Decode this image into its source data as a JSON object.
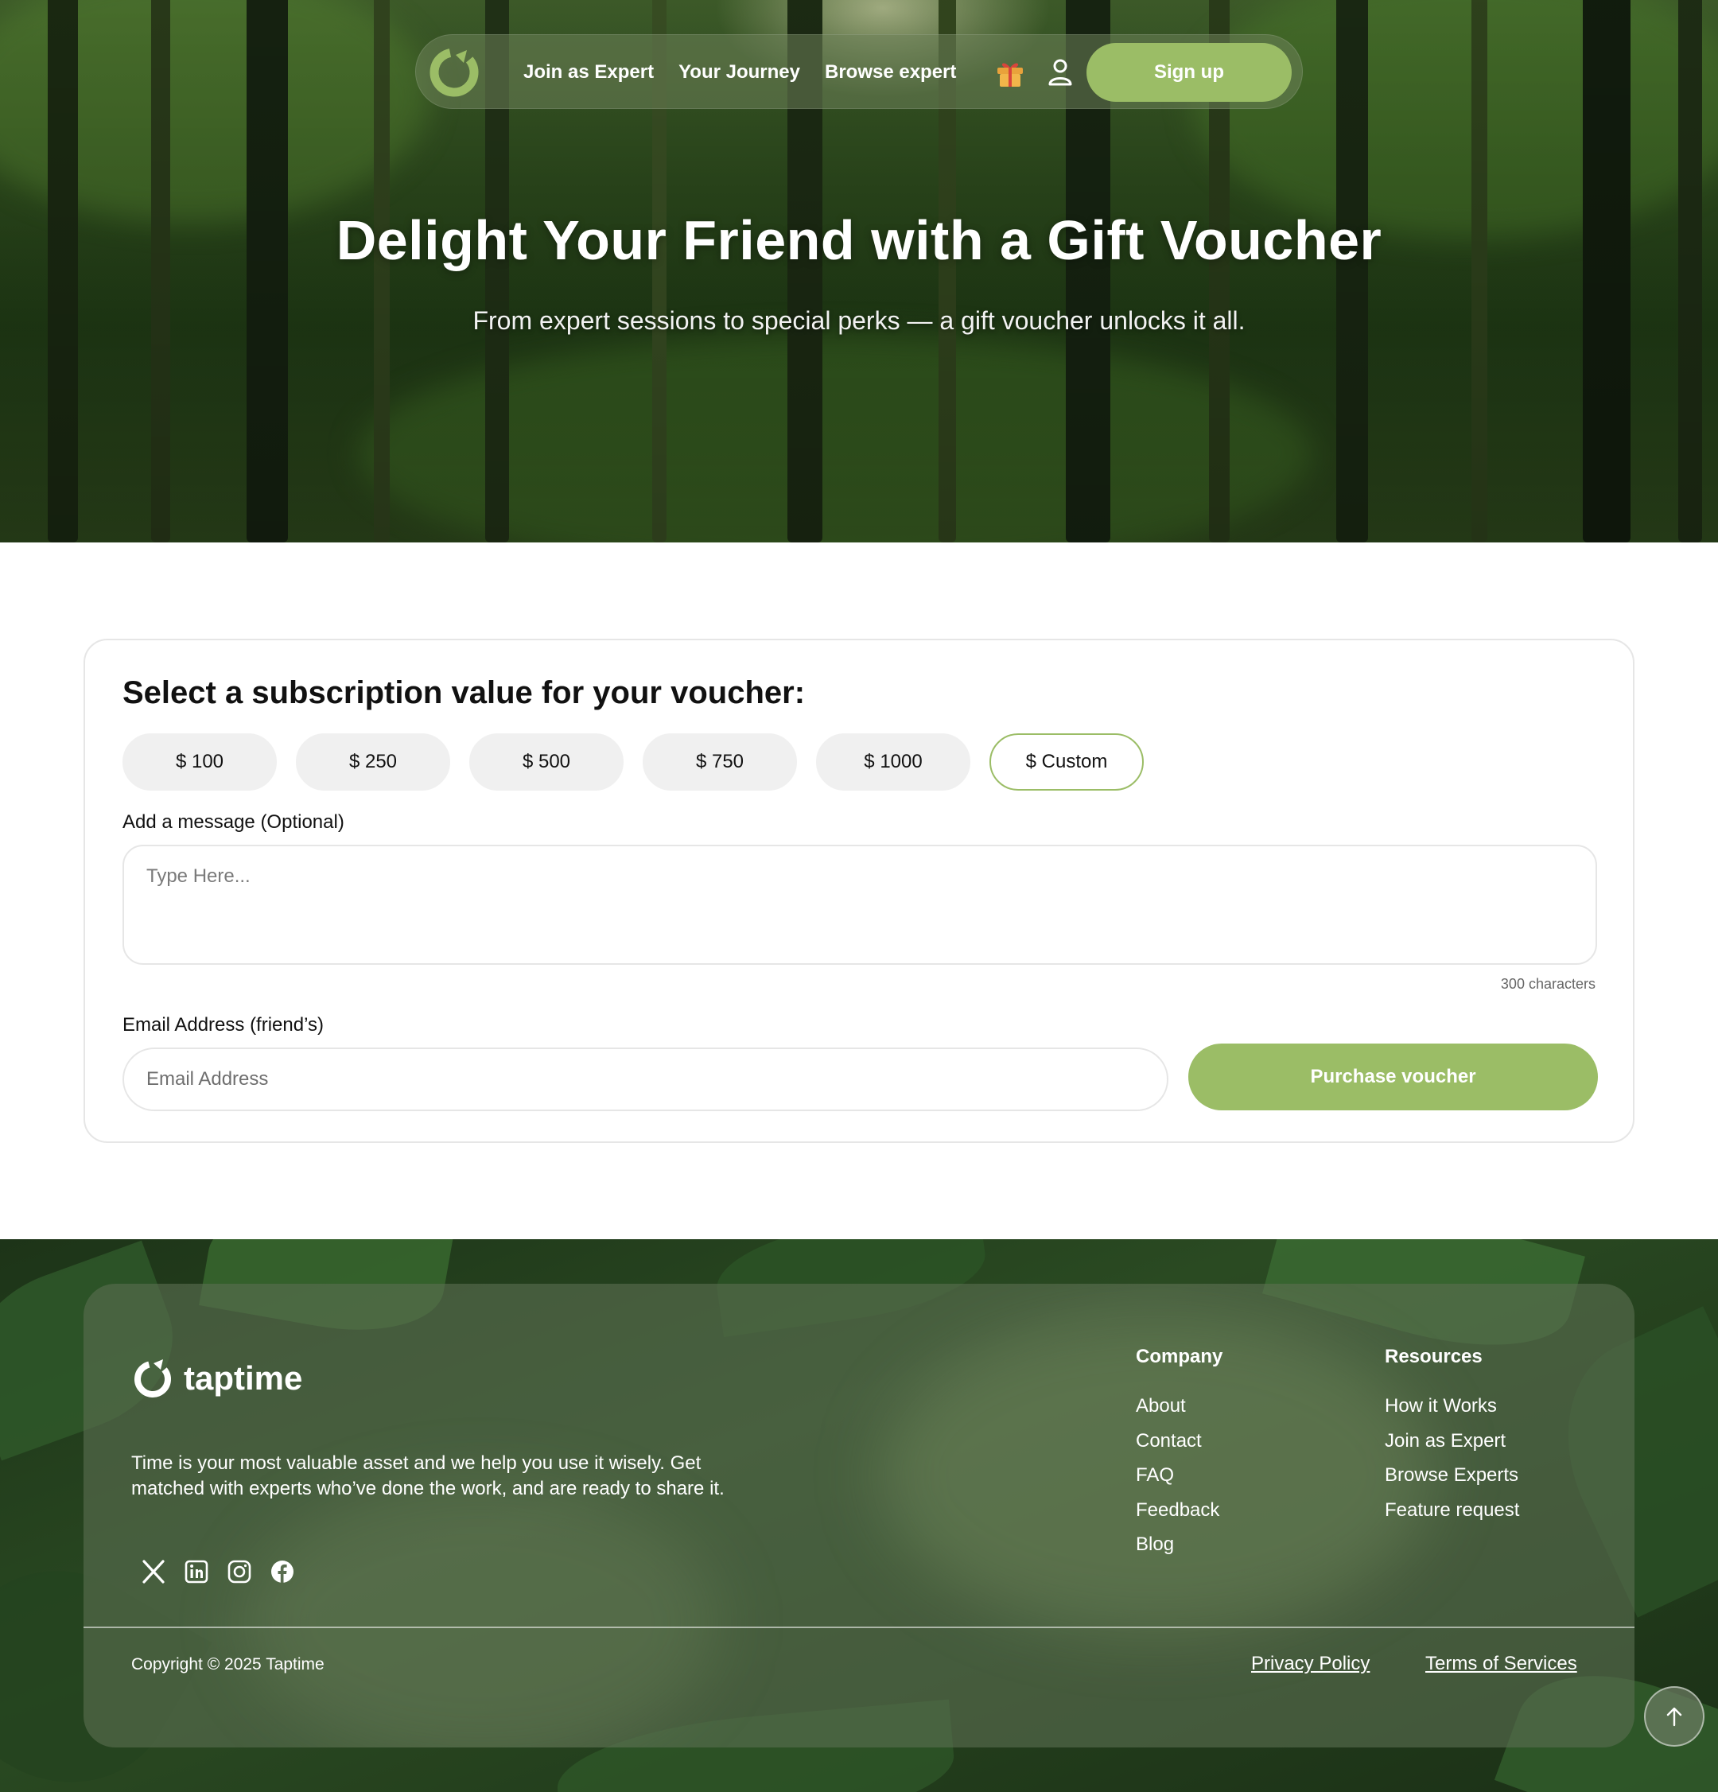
{
  "nav": {
    "links": [
      "Join as Expert",
      "Your Journey",
      "Browse expert"
    ],
    "signup_label": "Sign up",
    "icons": [
      "taptime-logo-icon",
      "gift-icon",
      "user-icon"
    ]
  },
  "hero": {
    "title": "Delight Your Friend with a Gift Voucher",
    "subtitle": "From expert sessions to special perks — a gift voucher unlocks it all."
  },
  "voucher": {
    "heading": "Select a subscription value for your voucher:",
    "amounts": [
      "$ 100",
      "$ 250",
      "$ 500",
      "$ 750",
      "$ 1000",
      "$ Custom"
    ],
    "selected": "$ Custom",
    "message_label": "Add a message  (Optional)",
    "message_placeholder": "Type Here...",
    "char_count": "300 characters",
    "email_label": "Email Address (friend’s)",
    "email_placeholder": "Email Address",
    "purchase_label": "Purchase voucher"
  },
  "footer": {
    "brand": "taptime",
    "about": "Time is your most valuable asset and we help you use it wisely. Get matched with experts who’ve done the work, and are ready to share it.",
    "socials": [
      "x-icon",
      "linkedin-icon",
      "instagram-icon",
      "facebook-icon"
    ],
    "company": {
      "heading": "Company",
      "items": [
        "About",
        "Contact",
        "FAQ",
        "Feedback",
        "Blog"
      ]
    },
    "resources": {
      "heading": "Resources",
      "items": [
        "How it Works",
        "Join as Expert",
        "Browse Experts",
        "Feature request"
      ]
    },
    "copyright": "Copyright © 2025 Taptime",
    "privacy": "Privacy Policy",
    "terms": "Terms of Services"
  },
  "colors": {
    "accent": "#9bbd66",
    "footer_panel": "#5a6e50"
  }
}
